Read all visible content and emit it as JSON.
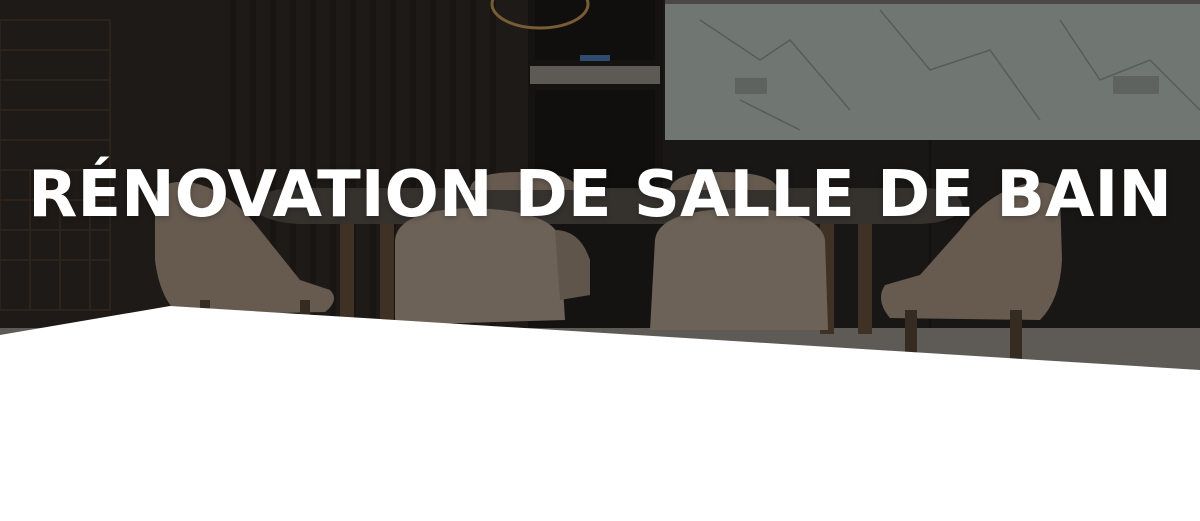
{
  "hero": {
    "title": "RÉNOVATION DE SALLE DE BAIN",
    "background_image": "dining-room-photo",
    "divider_shape": "white-diagonal-cut"
  },
  "colors": {
    "title_text": "#ffffff",
    "overlay": "#141210",
    "page_background": "#ffffff"
  }
}
